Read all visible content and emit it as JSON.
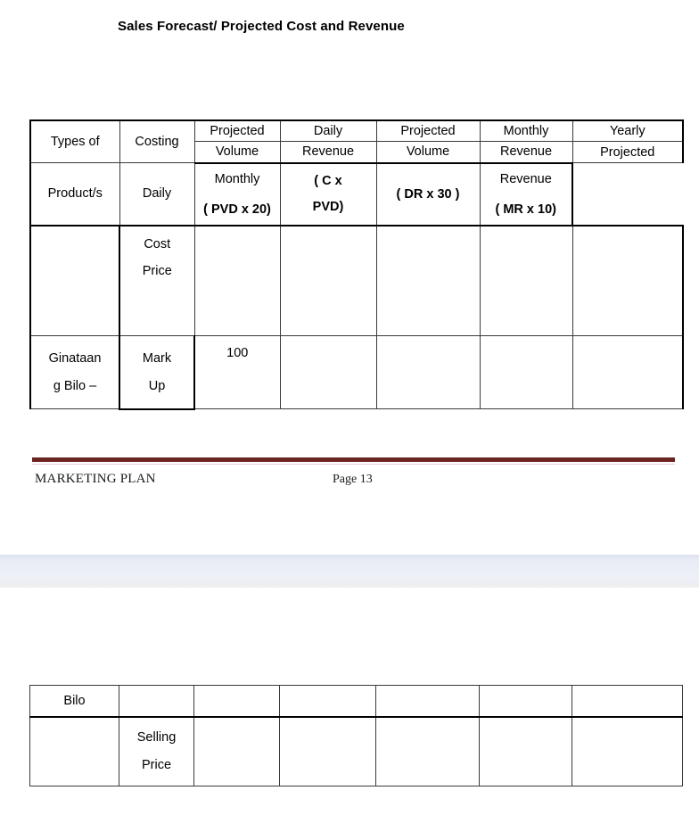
{
  "document": {
    "title": "Sales Forecast/ Projected Cost and Revenue"
  },
  "table_sales_forecast": {
    "name": "Sales Forecast/ Projected Cost and Revenue",
    "header_rows": [
      {
        "cells": [
          {
            "text": "Types of",
            "rowspan": 2,
            "bold": false
          },
          {
            "text": "Costing",
            "rowspan": 2,
            "bold": false
          },
          {
            "text": "Projected",
            "bold": false
          },
          {
            "text": "Daily",
            "bold": false
          },
          {
            "text": "Projected",
            "bold": false
          },
          {
            "text": "Monthly",
            "bold": false
          },
          {
            "text": "Yearly",
            "bold": false
          }
        ]
      },
      {
        "cells": [
          {
            "text": "Volume",
            "bold": false
          },
          {
            "text": "Revenue",
            "bold": false
          },
          {
            "text": "Volume",
            "bold": false
          },
          {
            "text": "Revenue",
            "bold": false
          },
          {
            "text": "Projected",
            "bold": false
          }
        ]
      },
      {
        "cells": [
          {
            "text": "Product/s",
            "bold": false
          },
          {
            "text": "Daily",
            "bold": false
          },
          {
            "text": "( C x  PVD)",
            "bold": true
          },
          {
            "text": "Monthly",
            "bold": false
          },
          {
            "text": "( DR x 30 )",
            "bold": true
          },
          {
            "text": "Revenue",
            "bold": false
          }
        ]
      },
      {
        "cells": [
          {
            "text": "( PVD x 20)",
            "bold": true
          },
          {
            "text": "( MR x 10)",
            "bold": true
          }
        ]
      }
    ],
    "header_labels": {
      "types_of": "Types of",
      "product_s": "Product/s",
      "costing": "Costing",
      "projected": "Projected",
      "volume": "Volume",
      "daily_small": "Daily",
      "daily": "Daily",
      "revenue": "Revenue",
      "c_x": "( C x",
      "pvd": "PVD)",
      "projected2": "Projected",
      "volume2": "Volume",
      "monthly_small": "Monthly",
      "pvd_x_20": "( PVD x 20)",
      "monthly": "Monthly",
      "revenue2": "Revenue",
      "dr_x_30": "( DR x 30 )",
      "yearly": "Yearly",
      "projected3": "Projected",
      "revenue3": "Revenue",
      "mr_x_10": "( MR x 10)"
    },
    "body_rows": [
      {
        "product": "",
        "costing_line1": "Cost",
        "costing_line2": "Price",
        "projected_volume_daily": "",
        "daily_revenue": "",
        "projected_volume_monthly": "",
        "monthly_revenue": "",
        "yearly_projected_revenue": ""
      },
      {
        "product_line1": "Ginataan",
        "product_line2": "g Bilo –",
        "costing_line1": "Mark",
        "costing_line2": "Up",
        "projected_volume_daily": "100",
        "daily_revenue": "",
        "projected_volume_monthly": "",
        "monthly_revenue": "",
        "yearly_projected_revenue": ""
      }
    ]
  },
  "table_selling_price": {
    "rows": [
      {
        "product": "Bilo",
        "costing": "",
        "projected_volume_daily": "",
        "daily_revenue": "",
        "projected_volume_monthly": "",
        "monthly_revenue": "",
        "yearly_projected_revenue": ""
      },
      {
        "product": "",
        "costing_line1": "Selling",
        "costing_line2": "Price",
        "projected_volume_daily": "",
        "daily_revenue": "",
        "projected_volume_monthly": "",
        "monthly_revenue": "",
        "yearly_projected_revenue": ""
      }
    ]
  },
  "footer": {
    "left_text": "MARKETING PLAN",
    "page_label": "Page 13",
    "rule_color": "#6b2420"
  },
  "page_break": {
    "band_color": "#eceff6"
  }
}
